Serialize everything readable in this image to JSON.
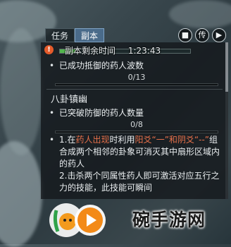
{
  "tabs": [
    {
      "label": "任务",
      "active": false
    },
    {
      "label": "副本",
      "active": true
    }
  ],
  "top_icons": [
    {
      "name": "book-icon",
      "glyph": "■"
    },
    {
      "name": "transmit-icon",
      "glyph": "传"
    },
    {
      "name": "arrow-icon",
      "glyph": "▶"
    }
  ],
  "dungeon": {
    "time_label": "副本剩余时间",
    "time_value": "1:23:43",
    "time_remaining_fraction": 0.12,
    "accent": "#52b54d"
  },
  "objectives": [
    {
      "text": "已成功抵御的药人波数",
      "counter": "0/13"
    },
    {
      "text": "已突破防御的药人数量",
      "counter": "0/8"
    }
  ],
  "section_title": "八卦镇幽",
  "description": {
    "line1_parts": [
      "1.在",
      "药人出现",
      "时利用",
      "阳爻“一”和阴爻“--”",
      "组合成两个相邻的卦象可消灭其中扇形区域内的药人"
    ],
    "line2": "2.击杀两个同属性药人即可激活对应五行之力的技能，此技能可瞬间",
    "highlight_color": "#e6704a"
  },
  "watermark": {
    "text": "碗手游网"
  }
}
